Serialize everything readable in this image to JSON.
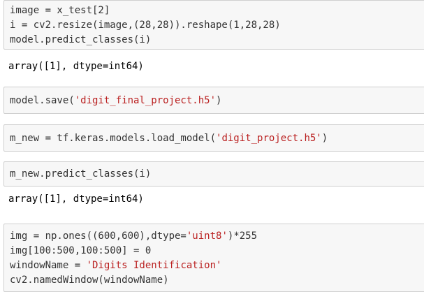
{
  "cells": [
    {
      "type": "code",
      "lines": [
        "image = x_test[2]",
        "i = cv2.resize(image,(28,28)).reshape(1,28,28)",
        "model.predict_classes(i)"
      ]
    },
    {
      "type": "output",
      "text": "array([1], dtype=int64)"
    },
    {
      "type": "code",
      "line_parts": {
        "pre": "model.save(",
        "str": "'digit_final_project.h5'",
        "post": ")"
      }
    },
    {
      "type": "code",
      "line_parts": {
        "pre": "m_new = tf.keras.models.load_model(",
        "str": "'digit_project.h5'",
        "post": ")"
      }
    },
    {
      "type": "code",
      "lines": [
        "m_new.predict_classes(i)"
      ]
    },
    {
      "type": "output",
      "text": "array([1], dtype=int64)"
    },
    {
      "type": "code",
      "line1_parts": {
        "pre": "img = np.ones((600,600),dtype=",
        "str": "'uint8'",
        "post": ")*255"
      },
      "line2": "img[100:500,100:500] = 0",
      "line3_parts": {
        "pre": "windowName = ",
        "str": "'Digits Identification'"
      },
      "line4": "cv2.namedWindow(windowName)"
    }
  ],
  "colors": {
    "cell_background": "#f7f7f7",
    "cell_border": "#cfcfcf",
    "string_literal": "#ba2121",
    "code_text": "#333333",
    "output_text": "#000000"
  }
}
